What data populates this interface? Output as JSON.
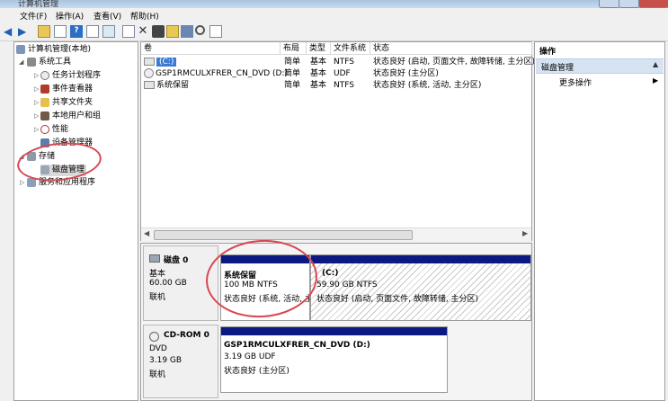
{
  "window": {
    "title": "计算机管理"
  },
  "menu": [
    "文件(F)",
    "操作(A)",
    "查看(V)",
    "帮助(H)"
  ],
  "tree": {
    "root": "计算机管理(本地)",
    "system_tools": "系统工具",
    "items": [
      "任务计划程序",
      "事件查看器",
      "共享文件夹",
      "本地用户和组",
      "性能",
      "设备管理器"
    ],
    "storage": "存储",
    "disk_mgmt": "磁盘管理",
    "services": "服务和应用程序"
  },
  "columns": [
    "卷",
    "布局",
    "类型",
    "文件系统",
    "状态"
  ],
  "volumes": [
    {
      "name": "(C:)",
      "layout": "简单",
      "type": "基本",
      "fs": "NTFS",
      "status": "状态良好 (启动, 页面文件, 故障转储, 主分区)"
    },
    {
      "name": "GSP1RMCULXFRER_CN_DVD (D:)",
      "layout": "简单",
      "type": "基本",
      "fs": "UDF",
      "status": "状态良好 (主分区)"
    },
    {
      "name": "系统保留",
      "layout": "简单",
      "type": "基本",
      "fs": "NTFS",
      "status": "状态良好 (系统, 活动, 主分区)"
    }
  ],
  "disks": [
    {
      "name": "磁盘 0",
      "type": "基本",
      "size": "60.00 GB",
      "state": "联机",
      "partitions": [
        {
          "title": "系统保留",
          "size": "100 MB NTFS",
          "status": "状态良好 (系统, 活动, 主"
        },
        {
          "title": "(C:)",
          "size": "59.90 GB NTFS",
          "status": "状态良好 (启动, 页面文件, 故障转储, 主分区)"
        }
      ]
    },
    {
      "name": "CD-ROM 0",
      "type": "DVD",
      "size": "3.19 GB",
      "state": "联机",
      "partitions": [
        {
          "title": "GSP1RMCULXFRER_CN_DVD (D:)",
          "size": "3.19 GB UDF",
          "status": "状态良好 (主分区)"
        }
      ]
    }
  ],
  "actions": {
    "header": "操作",
    "section": "磁盘管理",
    "more": "更多操作"
  },
  "colors": {
    "partition_bar": "#0a1a82",
    "highlight_circle": "#d9464f",
    "action_section": "#d6e3f3"
  }
}
